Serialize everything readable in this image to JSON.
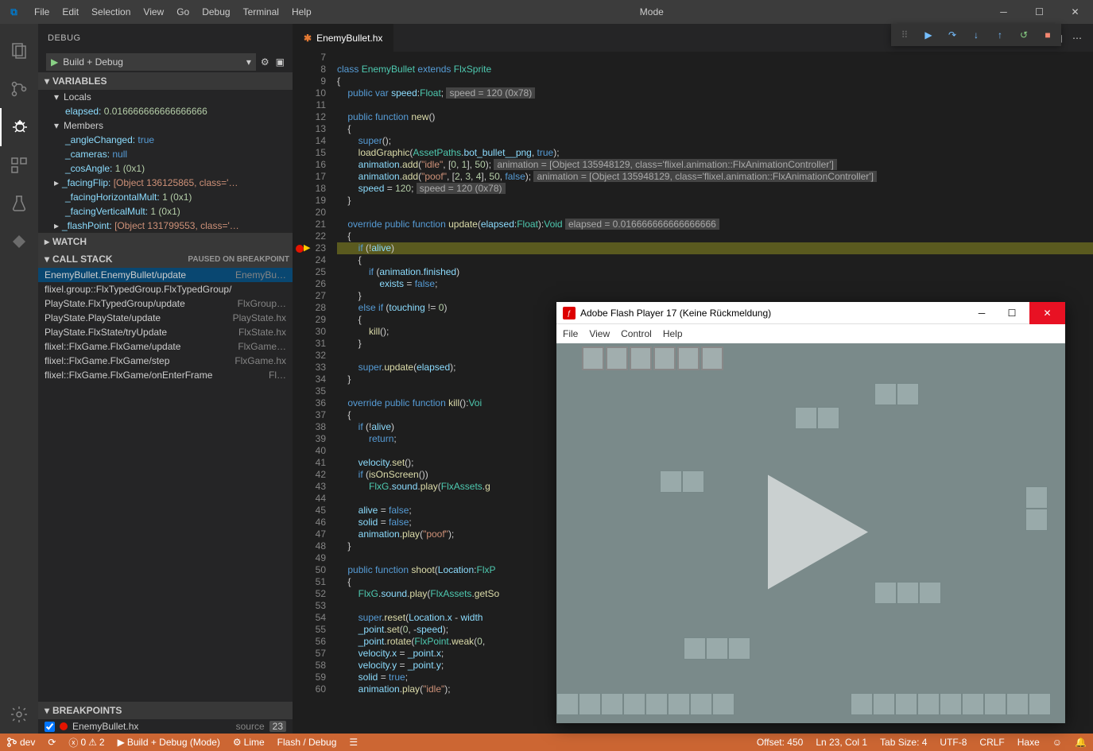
{
  "window": {
    "title": "Mode"
  },
  "menu": [
    "File",
    "Edit",
    "Selection",
    "View",
    "Go",
    "Debug",
    "Terminal",
    "Help"
  ],
  "sidebar_title": "DEBUG",
  "debug_config_name": "Build + Debug",
  "variables": {
    "title": "VARIABLES",
    "locals_label": "Locals",
    "members_label": "Members",
    "elapsed_name": "elapsed:",
    "elapsed_val": "0.016666666666666666",
    "members": [
      {
        "n": "_angleChanged:",
        "v": "true",
        "cls": "kw"
      },
      {
        "n": "_cameras:",
        "v": "null",
        "cls": "kw"
      },
      {
        "n": "_cosAngle:",
        "v": "1 (0x1)",
        "cls": "num"
      },
      {
        "n": "_facingFlip:",
        "v": "[Object 136125865, class='…",
        "cls": "v",
        "exp": true
      },
      {
        "n": "_facingHorizontalMult:",
        "v": "1 (0x1)",
        "cls": "num"
      },
      {
        "n": "_facingVerticalMult:",
        "v": "1 (0x1)",
        "cls": "num"
      },
      {
        "n": "_flashPoint:",
        "v": "[Object 131799553, class='…",
        "cls": "v",
        "exp": true
      }
    ]
  },
  "watch": {
    "title": "WATCH"
  },
  "callstack": {
    "title": "CALL STACK",
    "paused": "PAUSED ON BREAKPOINT",
    "items": [
      {
        "fn": "EnemyBullet.EnemyBullet/update",
        "fl": "EnemyBu…",
        "sel": true
      },
      {
        "fn": "flixel.group::FlxTypedGroup.FlxTypedGroup/",
        "fl": ""
      },
      {
        "fn": "PlayState.FlxTypedGroup/update",
        "fl": "FlxGroup…"
      },
      {
        "fn": "PlayState.PlayState/update",
        "fl": "PlayState.hx"
      },
      {
        "fn": "PlayState.FlxState/tryUpdate",
        "fl": "FlxState.hx"
      },
      {
        "fn": "flixel::FlxGame.FlxGame/update",
        "fl": "FlxGame…"
      },
      {
        "fn": "flixel::FlxGame.FlxGame/step",
        "fl": "FlxGame.hx"
      },
      {
        "fn": "flixel::FlxGame.FlxGame/onEnterFrame",
        "fl": "Fl…"
      }
    ]
  },
  "breakpoints": {
    "title": "BREAKPOINTS",
    "items": [
      {
        "file": "EnemyBullet.hx",
        "src": "source",
        "line": "23"
      }
    ]
  },
  "editor_tab": {
    "label": "EnemyBullet.hx"
  },
  "code_start_line": 7,
  "breakpoint_line": 23,
  "inline_vals": {
    "l8_anim1": "animation = [Object 135948129, class='flixel.animation::FlxAnimationController']",
    "l9_anim2": "animation = [Object 135948129, class='flixel.animation::FlxAnimationController']",
    "l10_speed": "speed = 120 (0x78)",
    "l5_speed": "speed = 120 (0x78)",
    "l21_elapsed": "elapsed = 0.016666666666666666"
  },
  "flash": {
    "title": "Adobe Flash Player 17 (Keine Rückmeldung)",
    "menu": [
      "File",
      "View",
      "Control",
      "Help"
    ]
  },
  "status": {
    "branch": "dev",
    "sync": "",
    "errors": "0",
    "warnings": "2",
    "build": "Build + Debug (Mode)",
    "lime": "Lime",
    "target": "Flash / Debug",
    "offset": "Offset: 450",
    "pos": "Ln 23, Col 1",
    "tab": "Tab Size: 4",
    "enc": "UTF-8",
    "eol": "CRLF",
    "lang": "Haxe"
  }
}
